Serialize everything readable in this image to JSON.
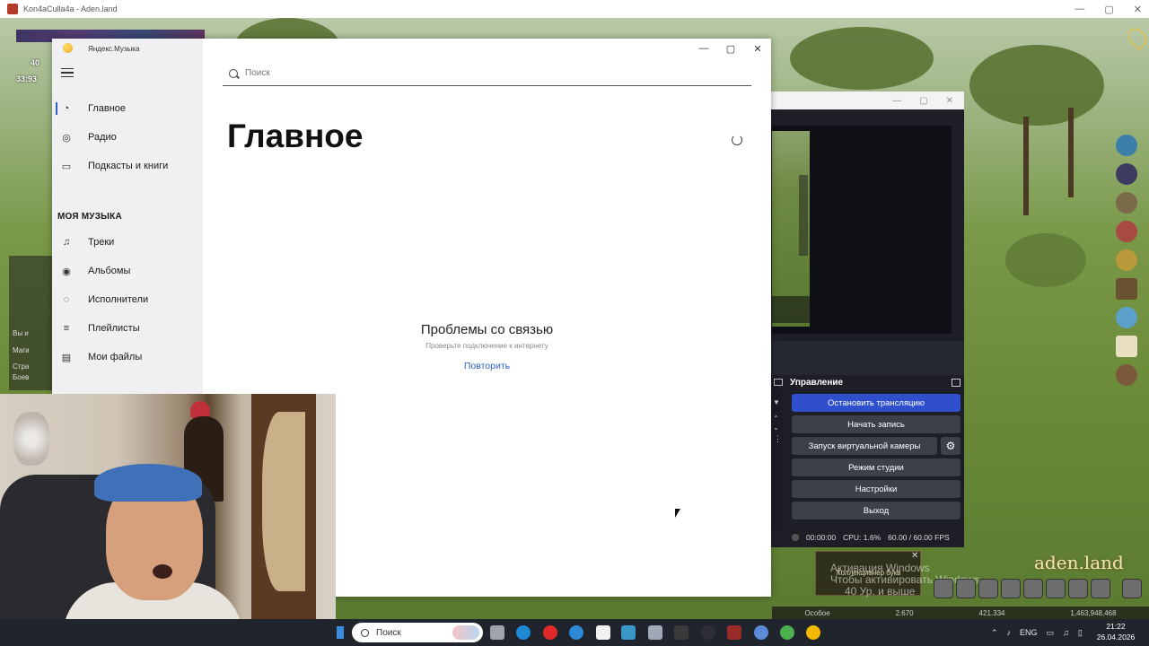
{
  "outer_window": {
    "title": "Kon4aCulla4a - Aden.land"
  },
  "game": {
    "hud_numbers": [
      "40",
      "33:93"
    ],
    "left_texts": [
      "Вы и",
      "Маги",
      "Стра",
      "Боев"
    ],
    "watermark_title": "Активация Windows",
    "watermark_sub": "Чтобы активировать Windows",
    "brand": "aden.land",
    "notification_title": "Коллекционер букв",
    "notification_sub": "40 Ур. и выше",
    "bottom_values": [
      "Особое",
      "2.670",
      "421.334",
      "1,463,948,468"
    ]
  },
  "yandex": {
    "title": "Яндекс.Музыка",
    "search_placeholder": "Поиск",
    "nav": [
      {
        "label": "Главное",
        "icon": "home-icon"
      },
      {
        "label": "Радио",
        "icon": "radio-icon"
      },
      {
        "label": "Подкасты и книги",
        "icon": "podcast-icon"
      }
    ],
    "section_title": "МОЯ МУЗЫКА",
    "my_music": [
      {
        "label": "Треки",
        "icon": "note-icon"
      },
      {
        "label": "Альбомы",
        "icon": "album-icon"
      },
      {
        "label": "Исполнители",
        "icon": "artist-icon"
      },
      {
        "label": "Плейлисты",
        "icon": "playlist-icon"
      },
      {
        "label": "Мои файлы",
        "icon": "folder-icon"
      }
    ],
    "page_title": "Главное",
    "error_title": "Проблемы со связью",
    "error_sub": "Проверьте подключение к интернету",
    "retry": "Повторить"
  },
  "obs": {
    "dock_title": "Управление",
    "buttons": {
      "stop_stream": "Остановить трансляцию",
      "start_record": "Начать запись",
      "virtual_cam": "Запуск виртуальной камеры",
      "studio_mode": "Режим студии",
      "settings": "Настройки",
      "exit": "Выход"
    },
    "status": {
      "time": "00:00:00",
      "cpu": "CPU: 1.6%",
      "fps": "60.00 / 60.00 FPS"
    },
    "colors": {
      "active": "#2f4fcc",
      "button": "#3c404b"
    }
  },
  "taskbar": {
    "search_placeholder": "Поиск",
    "lang": "ENG",
    "time": "21:22",
    "date": "26.04.2026"
  }
}
